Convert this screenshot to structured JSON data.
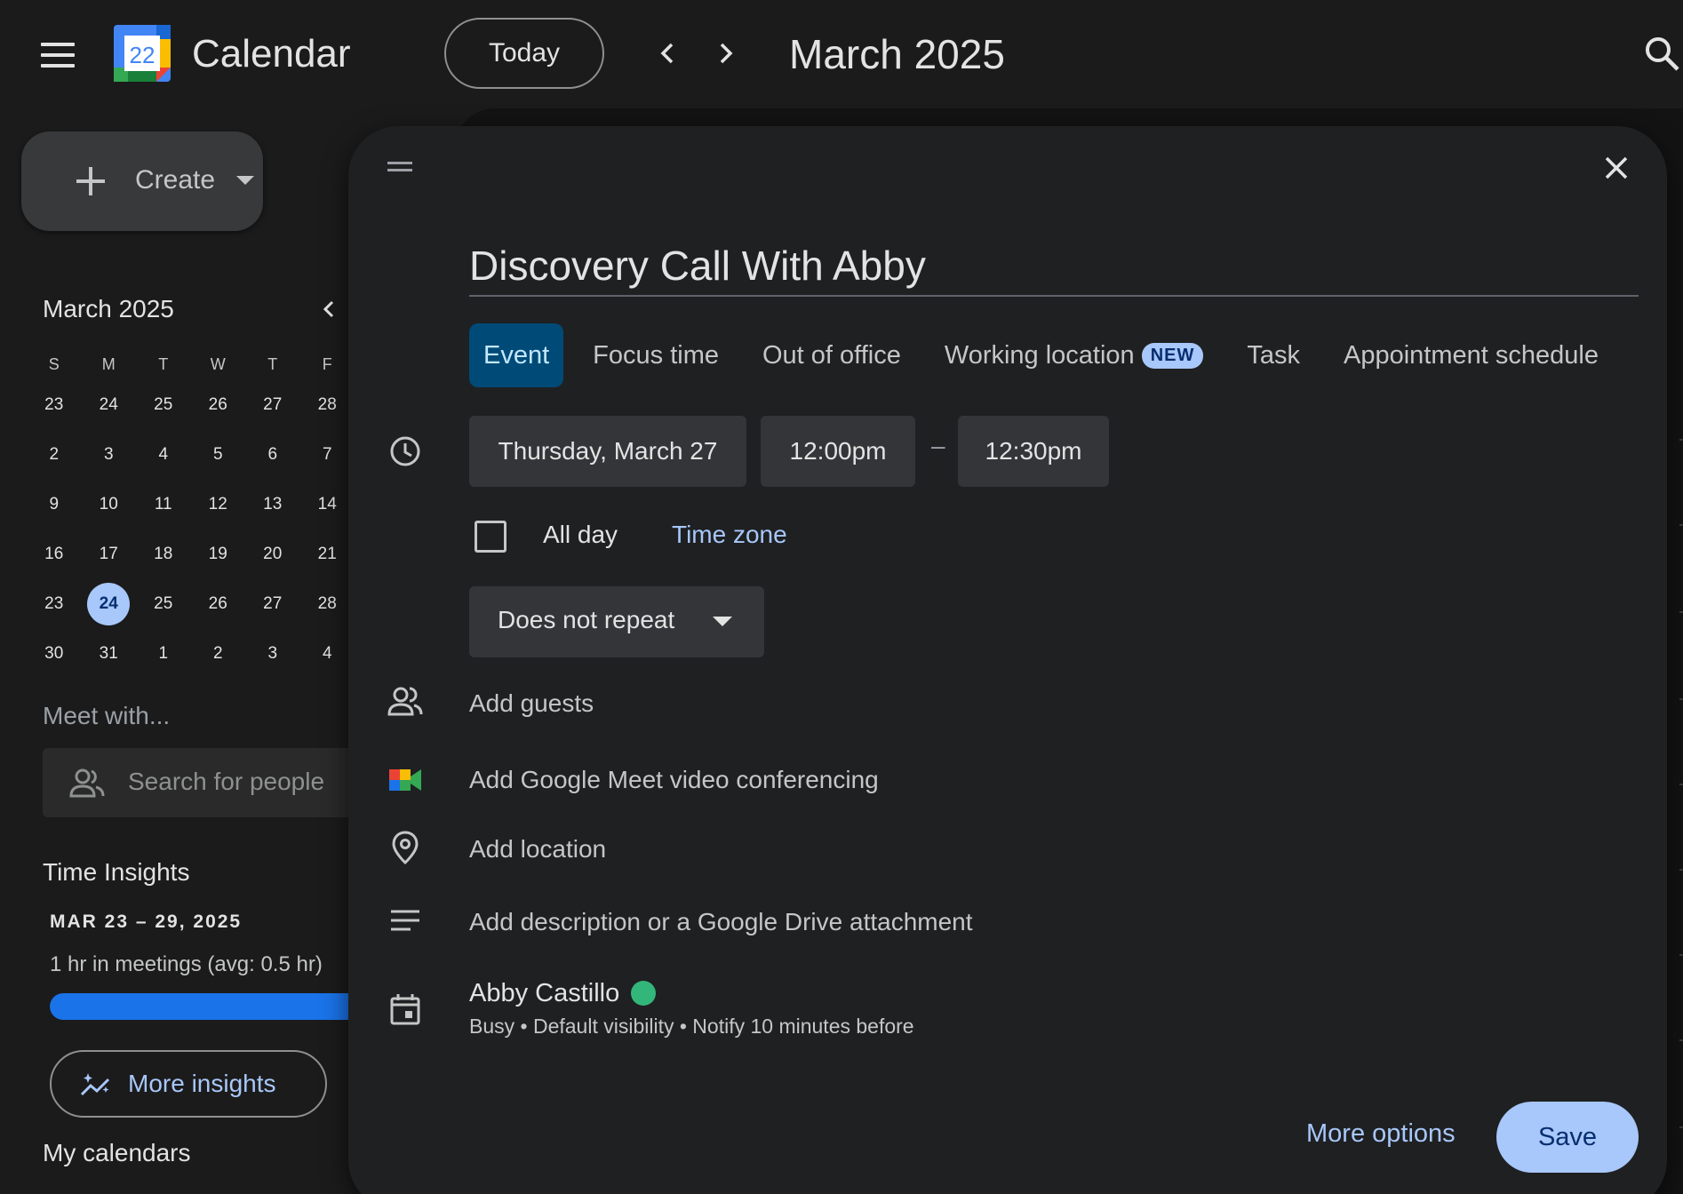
{
  "header": {
    "app_title": "Calendar",
    "logo_day": "22",
    "today_label": "Today",
    "month_label": "March 2025"
  },
  "sidebar": {
    "create_label": "Create",
    "mini_calendar": {
      "title": "March 2025",
      "weekdays": [
        "S",
        "M",
        "T",
        "W",
        "T",
        "F"
      ],
      "weeks": [
        [
          "23",
          "24",
          "25",
          "26",
          "27",
          "28"
        ],
        [
          "2",
          "3",
          "4",
          "5",
          "6",
          "7"
        ],
        [
          "9",
          "10",
          "11",
          "12",
          "13",
          "14"
        ],
        [
          "16",
          "17",
          "18",
          "19",
          "20",
          "21"
        ],
        [
          "23",
          "24",
          "25",
          "26",
          "27",
          "28"
        ],
        [
          "30",
          "31",
          "1",
          "2",
          "3",
          "4"
        ]
      ],
      "today": "24"
    },
    "meet_with_title": "Meet with...",
    "people_search_placeholder": "Search for people",
    "time_insights": {
      "title": "Time Insights",
      "range": "MAR 23 – 29, 2025",
      "summary": "1 hr in meetings (avg: 0.5 hr)",
      "more_label": "More insights"
    },
    "my_calendars_title": "My calendars"
  },
  "dialog": {
    "title_value": "Discovery Call With Abby",
    "tabs": [
      {
        "label": "Event",
        "active": true
      },
      {
        "label": "Focus time"
      },
      {
        "label": "Out of office"
      },
      {
        "label": "Working location",
        "badge": "NEW"
      },
      {
        "label": "Task"
      },
      {
        "label": "Appointment schedule"
      }
    ],
    "date": "Thursday, March 27",
    "start_time": "12:00pm",
    "time_separator": "–",
    "end_time": "12:30pm",
    "all_day_label": "All day",
    "time_zone_label": "Time zone",
    "repeat_label": "Does not repeat",
    "add_guests": "Add guests",
    "add_meet": "Add Google Meet video conferencing",
    "add_location": "Add location",
    "add_description": "Add description or a Google Drive attachment",
    "owner_name": "Abby Castillo",
    "owner_meta": "Busy • Default visibility • Notify 10 minutes before",
    "more_options_label": "More options",
    "save_label": "Save"
  },
  "colors": {
    "accent": "#a8c7fa",
    "active_tab_bg": "#004a77",
    "owner_color": "#33b679",
    "insights_bar": "#1a73e8"
  }
}
